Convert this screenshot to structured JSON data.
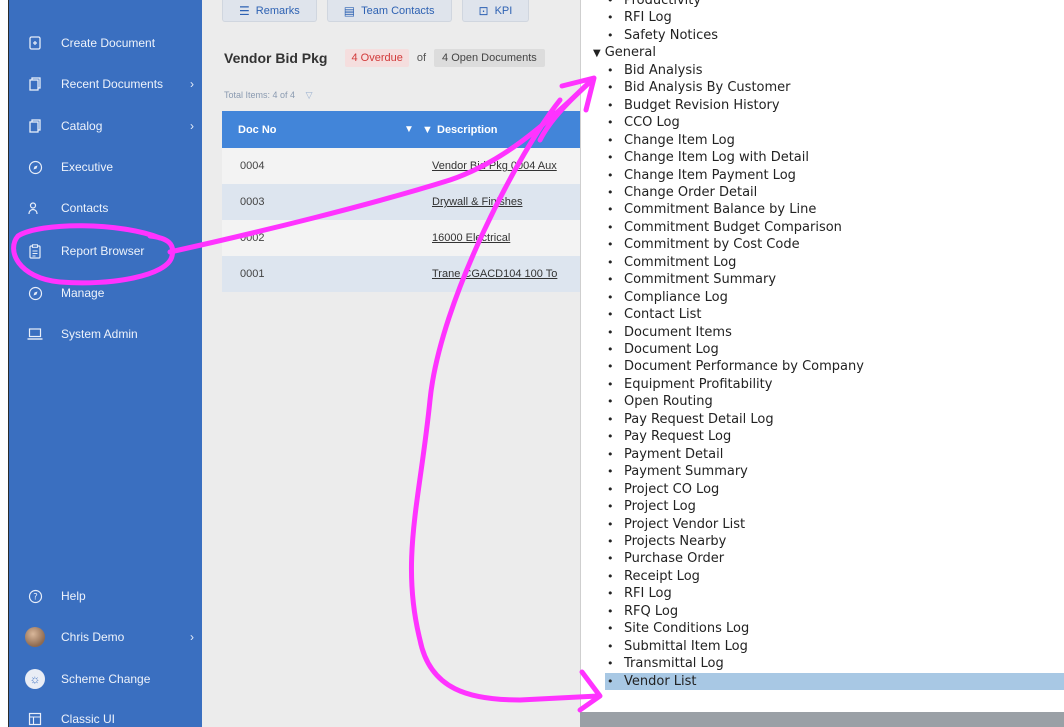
{
  "sidebar": {
    "items": [
      {
        "label": "Create Document",
        "icon": "document-plus-icon",
        "chevron": false
      },
      {
        "label": "Recent Documents",
        "icon": "documents-icon",
        "chevron": true
      },
      {
        "label": "Catalog",
        "icon": "catalog-icon",
        "chevron": true
      },
      {
        "label": "Executive",
        "icon": "compass-icon",
        "chevron": false
      },
      {
        "label": "Contacts",
        "icon": "contacts-icon",
        "chevron": false
      },
      {
        "label": "Report Browser",
        "icon": "clipboard-icon",
        "chevron": false
      },
      {
        "label": "Manage",
        "icon": "compass-icon",
        "chevron": false
      },
      {
        "label": "System Admin",
        "icon": "laptop-icon",
        "chevron": false
      }
    ],
    "bottom": [
      {
        "label": "Help",
        "icon": "help-icon",
        "chevron": false
      },
      {
        "label": "Chris Demo",
        "icon": "user-avatar",
        "chevron": true
      },
      {
        "label": "Scheme Change",
        "icon": "sun-icon",
        "chevron": false
      },
      {
        "label": "Classic UI",
        "icon": "layout-icon",
        "chevron": false
      }
    ]
  },
  "tabs": [
    {
      "label": "Remarks",
      "icon": "remarks-icon"
    },
    {
      "label": "Team Contacts",
      "icon": "contacts-card-icon"
    },
    {
      "label": "KPI",
      "icon": "chart-icon"
    }
  ],
  "document": {
    "title": "Vendor Bid Pkg",
    "overdue": "4 Overdue",
    "of": "of",
    "open": "4 Open Documents",
    "total": "Total Items: 4 of 4"
  },
  "grid": {
    "columns": [
      "Doc No",
      "Description"
    ],
    "rows": [
      {
        "doc_no": "0004",
        "description": "Vendor Bid Pkg 0004 Aux"
      },
      {
        "doc_no": "0003",
        "description": "Drywall & Finishes"
      },
      {
        "doc_no": "0002",
        "description": "16000 Electrical"
      },
      {
        "doc_no": "0001",
        "description": "Trane CGACD104 100 To"
      }
    ]
  },
  "reports": {
    "top_items": [
      "Productivity",
      "RFI Log",
      "Safety Notices"
    ],
    "group_label": "General",
    "general_items": [
      "Bid Analysis",
      "Bid Analysis By Customer",
      "Budget Revision History",
      "CCO Log",
      "Change Item Log",
      "Change Item Log with Detail",
      "Change Item Payment Log",
      "Change Order Detail",
      "Commitment Balance by Line",
      "Commitment Budget Comparison",
      "Commitment by Cost Code",
      "Commitment Log",
      "Commitment Summary",
      "Compliance Log",
      "Contact List",
      "Document Items",
      "Document Log",
      "Document Performance by Company",
      "Equipment Profitability",
      "Open Routing",
      "Pay Request Detail Log",
      "Pay Request Log",
      "Payment Detail",
      "Payment Summary",
      "Project CO Log",
      "Project Log",
      "Project Vendor List",
      "Projects Nearby",
      "Purchase Order",
      "Receipt Log",
      "RFI Log",
      "RFQ Log",
      "Site Conditions Log",
      "Submittal Item Log",
      "Transmittal Log",
      "Vendor List"
    ],
    "selected": "Vendor List"
  },
  "colors": {
    "sidebar": "#3a6fc0",
    "grid_header": "#4285d9",
    "annotation": "#ff33ff",
    "selection": "#a8c8e4"
  }
}
